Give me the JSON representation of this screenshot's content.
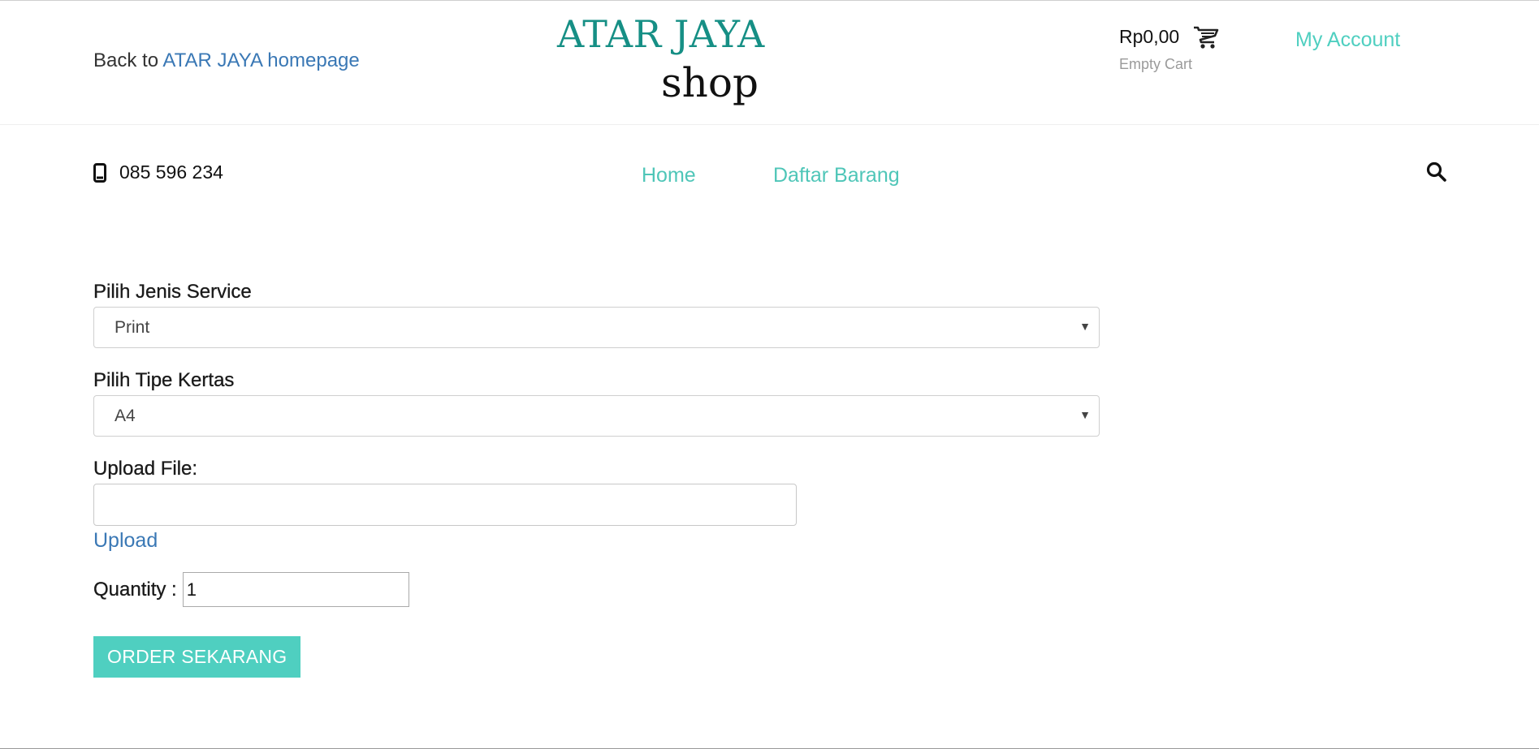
{
  "header": {
    "back_prefix": "Back to",
    "back_link": "ATAR JAYA homepage",
    "logo_top": "ATAR JAYA",
    "logo_bottom": "shop",
    "cart_total": "Rp0,00",
    "cart_status": "Empty Cart",
    "account_link": "My Account"
  },
  "nav": {
    "phone": "085 596 234",
    "links": [
      "Home",
      "Daftar Barang"
    ]
  },
  "form": {
    "service_label": "Pilih Jenis Service",
    "service_value": "Print",
    "paper_label": "Pilih Tipe Kertas",
    "paper_value": "A4",
    "upload_label": "Upload File:",
    "upload_value": "",
    "upload_link": "Upload",
    "quantity_label": "Quantity :",
    "quantity_value": "1",
    "order_button": "ORDER SEKARANG"
  },
  "icons": {
    "cart": "cart-icon",
    "phone": "mobile-phone-icon",
    "search": "search-icon",
    "caret": "chevron-down-icon"
  },
  "colors": {
    "accent": "#4fcfc0",
    "link": "#3a78b5",
    "logo": "#168f85"
  }
}
